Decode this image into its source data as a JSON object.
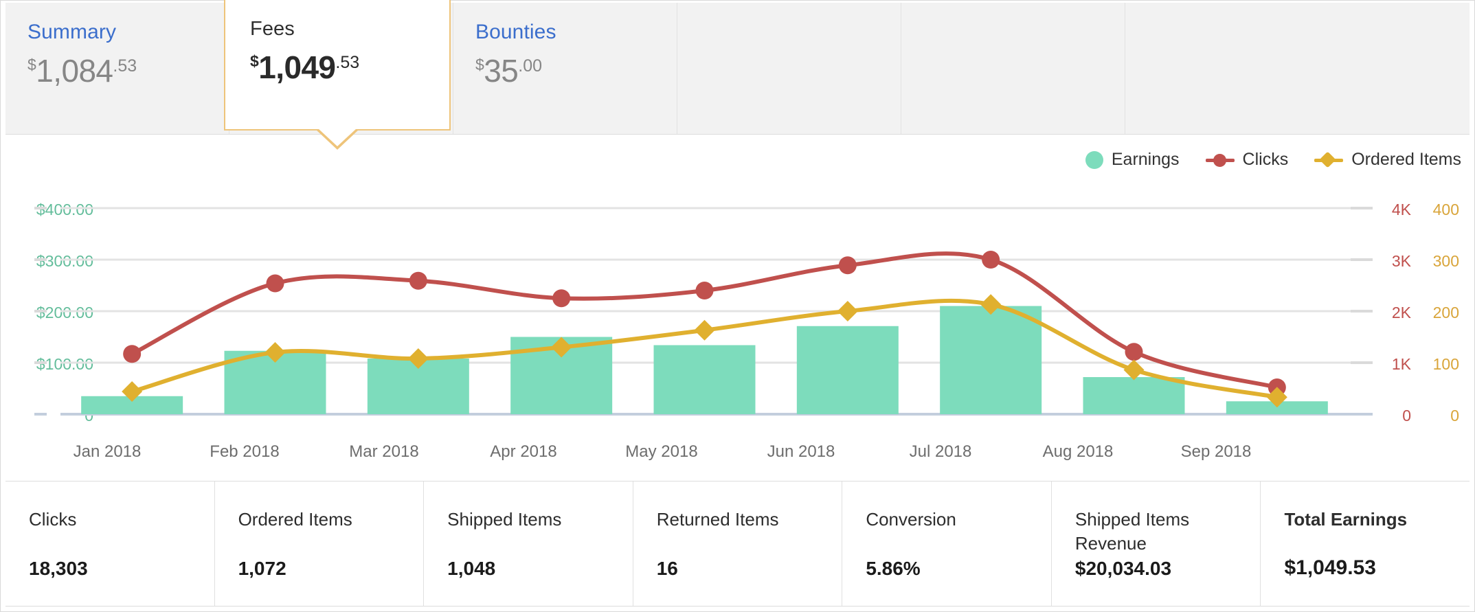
{
  "tabs": [
    {
      "label": "Summary",
      "currency": "$",
      "whole": "1,084",
      "cents": ".53",
      "selected": false
    },
    {
      "label": "Fees",
      "currency": "$",
      "whole": "1,049",
      "cents": ".53",
      "selected": true
    },
    {
      "label": "Bounties",
      "currency": "$",
      "whole": "35",
      "cents": ".00",
      "selected": false
    }
  ],
  "legend": [
    {
      "label": "Earnings",
      "color": "#7ddcbc",
      "marker": "circle-filled"
    },
    {
      "label": "Clicks",
      "color": "#c0504d",
      "marker": "line-circle"
    },
    {
      "label": "Ordered Items",
      "color": "#e0b02f",
      "marker": "line-diamond"
    }
  ],
  "stats": [
    {
      "label": "Clicks",
      "value": "18,303",
      "emphasis": false
    },
    {
      "label": "Ordered Items",
      "value": "1,072",
      "emphasis": false
    },
    {
      "label": "Shipped Items",
      "value": "1,048",
      "emphasis": false
    },
    {
      "label": "Returned Items",
      "value": "16",
      "emphasis": false
    },
    {
      "label": "Conversion",
      "value": "5.86%",
      "emphasis": false
    },
    {
      "label": "Shipped Items Revenue",
      "value": "$20,034.03",
      "emphasis": false
    },
    {
      "label": "Total Earnings",
      "value": "$1,049.53",
      "emphasis": true
    }
  ],
  "chart_data": {
    "type": "bar",
    "title": "",
    "xlabel": "",
    "grid": true,
    "legend_position": "top-right",
    "categories": [
      "Jan 2018",
      "Feb 2018",
      "Mar 2018",
      "Apr 2018",
      "May 2018",
      "Jun 2018",
      "Jul 2018",
      "Aug 2018",
      "Sep 2018"
    ],
    "axes": {
      "left": {
        "name": "Earnings",
        "color": "#63bd9b",
        "ticks": [
          "0",
          "$100.00",
          "$200.00",
          "$300.00",
          "$400.00"
        ],
        "tick_values": [
          0,
          100,
          200,
          300,
          400
        ],
        "range": [
          0,
          400
        ]
      },
      "right_1": {
        "name": "Clicks",
        "color": "#c0504d",
        "ticks": [
          "0",
          "1K",
          "2K",
          "3K",
          "4K"
        ],
        "tick_values": [
          0,
          1000,
          2000,
          3000,
          4000
        ],
        "range": [
          0,
          4000
        ]
      },
      "right_2": {
        "name": "Ordered Items",
        "color": "#d9a53a",
        "ticks": [
          "0",
          "100",
          "200",
          "300",
          "400"
        ],
        "tick_values": [
          0,
          100,
          200,
          300,
          400
        ],
        "range": [
          0,
          400
        ]
      }
    },
    "series": [
      {
        "name": "Earnings",
        "type": "bar",
        "axis": "left",
        "color": "#7ddcbc",
        "values": [
          35,
          123,
          108,
          150,
          134,
          171,
          210,
          72,
          25
        ]
      },
      {
        "name": "Clicks",
        "type": "line",
        "axis": "right_1",
        "color": "#c0504d",
        "values": [
          1170,
          2540,
          2590,
          2250,
          2400,
          2890,
          3000,
          1210,
          520
        ]
      },
      {
        "name": "Ordered Items",
        "type": "line",
        "axis": "right_2",
        "color": "#e0b02f",
        "values": [
          44,
          120,
          108,
          130,
          163,
          200,
          213,
          86,
          33
        ]
      }
    ]
  }
}
